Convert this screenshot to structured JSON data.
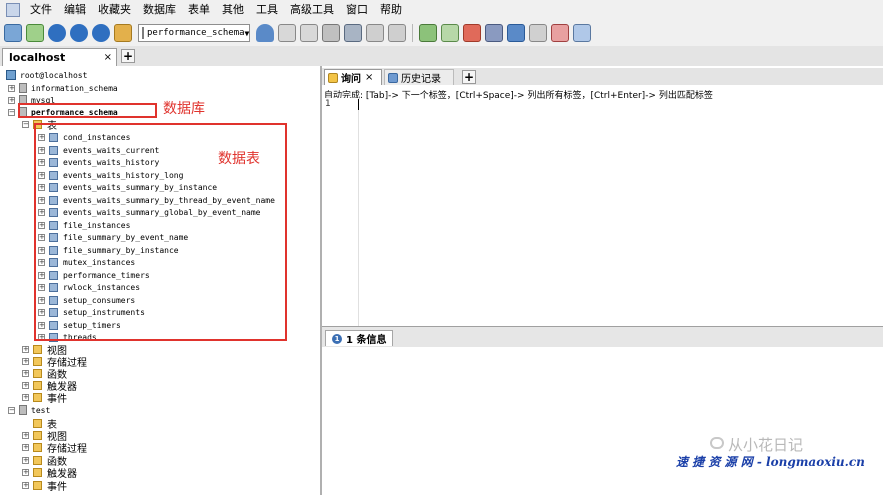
{
  "menu": [
    "文件",
    "编辑",
    "收藏夹",
    "数据库",
    "表单",
    "其他",
    "工具",
    "高级工具",
    "窗口",
    "帮助"
  ],
  "toolbar": {
    "db_select": "performance_schema"
  },
  "connection_tab": {
    "label": "localhost",
    "close": "×",
    "add": "+"
  },
  "tree": {
    "root": "root@localhost",
    "databases": [
      "information_schema",
      "mysql",
      "performance_schema"
    ],
    "tables_folder": "表",
    "tables": [
      "cond_instances",
      "events_waits_current",
      "events_waits_history",
      "events_waits_history_long",
      "events_waits_summary_by_instance",
      "events_waits_summary_by_thread_by_event_name",
      "events_waits_summary_global_by_event_name",
      "file_instances",
      "file_summary_by_event_name",
      "file_summary_by_instance",
      "mutex_instances",
      "performance_timers",
      "rwlock_instances",
      "setup_consumers",
      "setup_instruments",
      "setup_timers",
      "threads"
    ],
    "folders": [
      "视图",
      "存储过程",
      "函数",
      "触发器",
      "事件"
    ],
    "db_test": "test",
    "test_folders": [
      "表",
      "视图",
      "存储过程",
      "函数",
      "触发器",
      "事件"
    ]
  },
  "annotations": {
    "database": "数据库",
    "table": "数据表"
  },
  "editor": {
    "tab_query": "询问",
    "tab_close": "×",
    "tab_history": "历史记录",
    "tab_add": "+",
    "hint": "自动完成:  [Tab]-> 下一个标签，[Ctrl+Space]-> 列出所有标签，[Ctrl+Enter]-> 列出匹配标签",
    "line": "1"
  },
  "result_tab": {
    "badge": "1",
    "label": "1 条信息"
  },
  "watermark": "从小花日记",
  "footer": "速 捷 资 源 网 - longmaoxiu.cn",
  "colors": {
    "annotation_red": "#e0332d",
    "footer_blue": "#1a3fa8"
  }
}
